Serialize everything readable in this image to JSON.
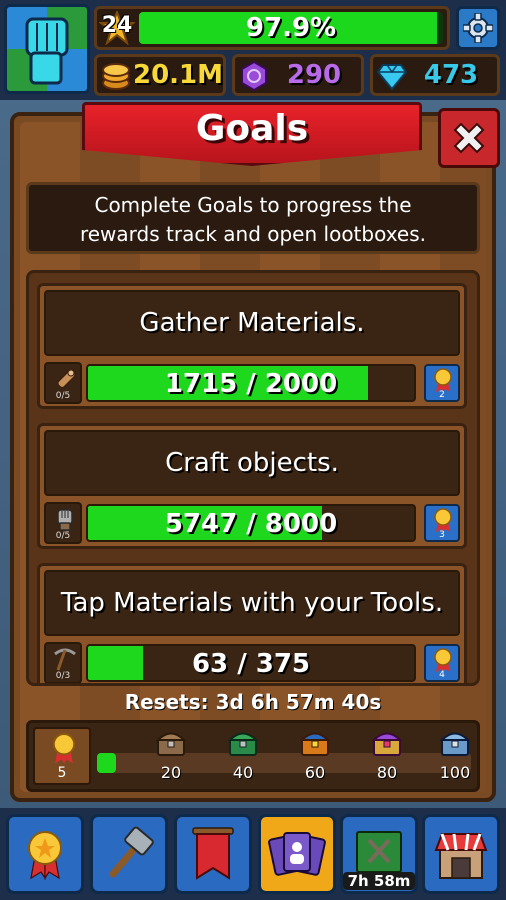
{
  "hud": {
    "level": "24",
    "xp_percent_text": "97.9%",
    "xp_fraction": 0.979,
    "coins": "20.1M",
    "gems": "290",
    "diamonds": "473"
  },
  "panel": {
    "title": "Goals",
    "description_line1": "Complete Goals to progress the",
    "description_line2": "rewards track and open lootboxes."
  },
  "goals": [
    {
      "title": "Gather Materials.",
      "icon": "log-icon",
      "count": "0/5",
      "progress_text": "1715 / 2000",
      "progress": 0.8575,
      "reward": "2"
    },
    {
      "title": "Craft objects.",
      "icon": "gauntlet-icon",
      "count": "0/5",
      "progress_text": "5747 / 8000",
      "progress": 0.718,
      "reward": "3"
    },
    {
      "title": "Tap Materials with your Tools.",
      "icon": "pickaxe-icon",
      "count": "0/3",
      "progress_text": "63 / 375",
      "progress": 0.168,
      "reward": "4"
    }
  ],
  "resets_text": "Resets: 3d 6h 57m 40s",
  "track": {
    "medals": "5",
    "progress": 0.05,
    "milestones": [
      "20",
      "40",
      "60",
      "80",
      "100"
    ]
  },
  "nav": {
    "items": [
      "medal-icon",
      "hammer-icon",
      "banner-icon",
      "cards-icon",
      "map-icon",
      "shop-icon"
    ],
    "active_index": 3,
    "map_timer": "7h 58m"
  },
  "colors": {
    "progress_green": "#1ed81e",
    "ribbon_red": "#d81e26",
    "nav_blue": "#2a6ac0",
    "active_orange": "#f0a818"
  }
}
